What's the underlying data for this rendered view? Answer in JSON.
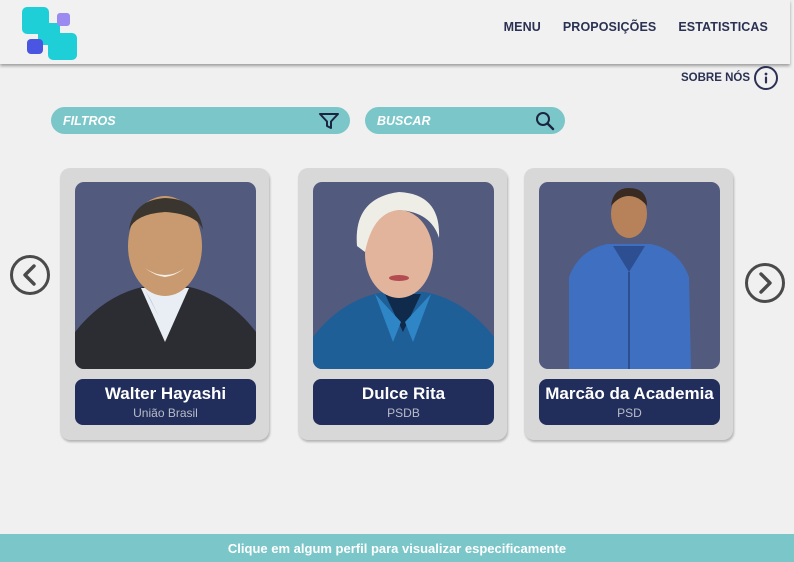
{
  "header": {
    "nav": [
      "MENU",
      "PROPOSIÇÕES",
      "ESTATISTICAS"
    ],
    "about_label": "SOBRE NÓS"
  },
  "filters": {
    "label": "FILTROS",
    "icon": "filter-icon"
  },
  "search": {
    "label": "BUSCAR",
    "icon": "search-icon"
  },
  "cards": [
    {
      "name": "Walter Hayashi",
      "party": "União Brasil"
    },
    {
      "name": "Dulce Rita",
      "party": "PSDB"
    },
    {
      "name": "Marcão da Academia",
      "party": "PSD"
    }
  ],
  "footer": {
    "text": "Clique em algum perfil para visualizar especificamente"
  },
  "colors": {
    "accent": "#7ac6c9",
    "navy": "#212d5a",
    "photo_bg": "#525a7e",
    "logo_cyan": "#1fcfd8",
    "logo_purple": "#9b8af0",
    "logo_blue": "#4a56e2"
  }
}
